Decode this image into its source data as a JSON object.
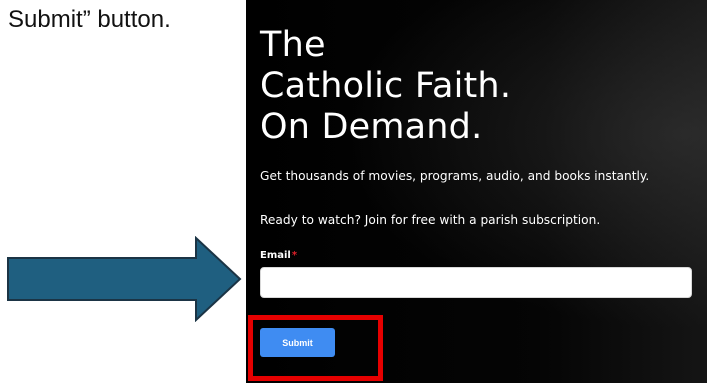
{
  "instruction": {
    "caption": "Submit” button."
  },
  "annotations": {
    "arrow_color": "#1f5f80",
    "arrow_border_color": "#1b3445",
    "highlight_color": "#e60000"
  },
  "page": {
    "background_color": "#000000",
    "hero": {
      "line1": "The",
      "line2": "Catholic Faith.",
      "line3": "On Demand."
    },
    "subtitle": "Get thousands of movies, programs, audio, and books instantly.",
    "cta": "Ready to watch? Join for free with a parish subscription.",
    "form": {
      "email_label": "Email",
      "required_marker": "*",
      "email_value": "",
      "email_placeholder": "",
      "submit_label": "Submit",
      "submit_color": "#3f8cf2"
    }
  }
}
